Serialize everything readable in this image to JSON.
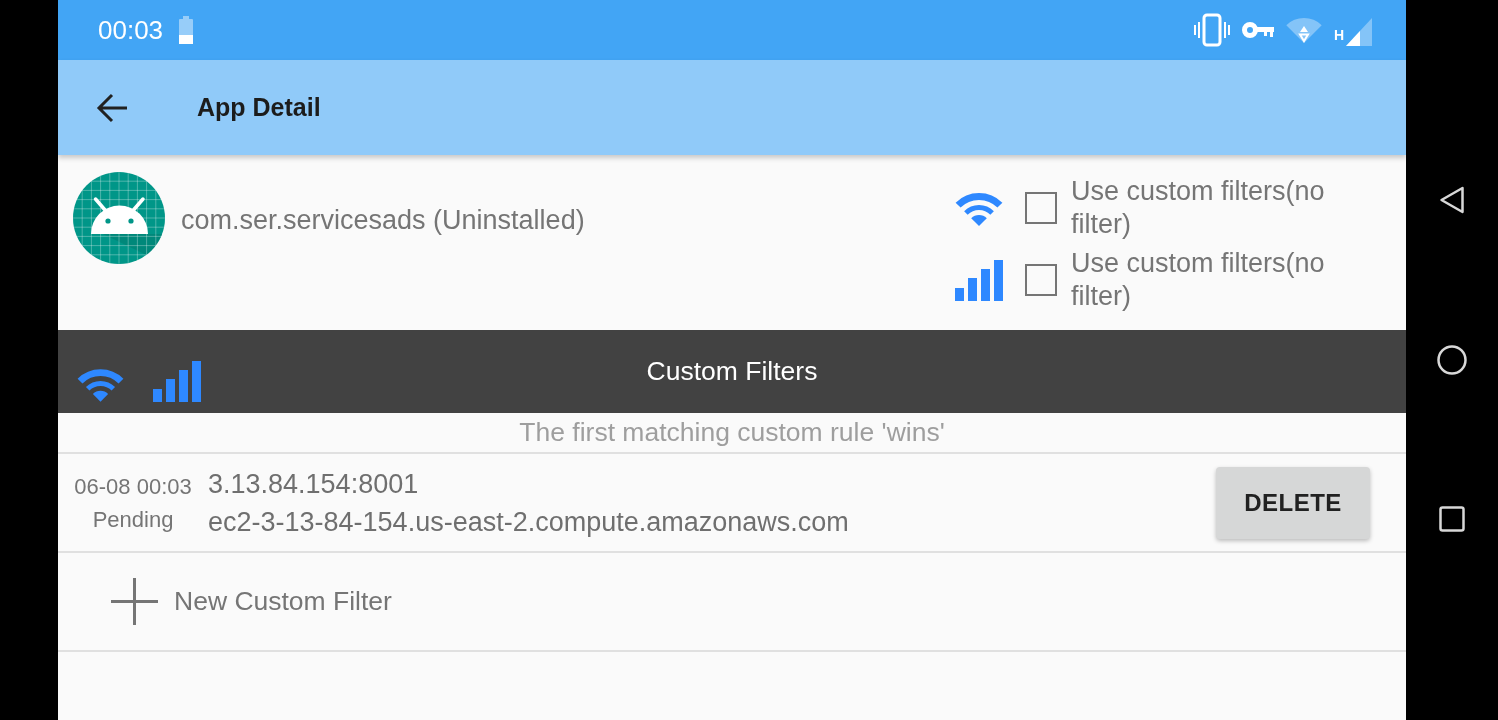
{
  "status_bar": {
    "time": "00:03",
    "network_type": "H"
  },
  "app_bar": {
    "title": "App Detail"
  },
  "app": {
    "name": "com.ser.servicesads (Uninstalled)"
  },
  "filter_settings": [
    {
      "kind": "wifi",
      "label": "Use custom filters(no filter)",
      "checked": false
    },
    {
      "kind": "mobile",
      "label": "Use custom filters(no filter)",
      "checked": false
    }
  ],
  "custom_filters": {
    "title": "Custom Filters",
    "hint": "The first matching custom rule 'wins'",
    "rules": [
      {
        "time": "06-08 00:03",
        "status": "Pending",
        "address": "3.13.84.154:8001",
        "host": "ec2-3-13-84-154.us-east-2.compute.amazonaws.com",
        "delete_button": "DELETE"
      }
    ],
    "add_button": "New Custom Filter"
  }
}
